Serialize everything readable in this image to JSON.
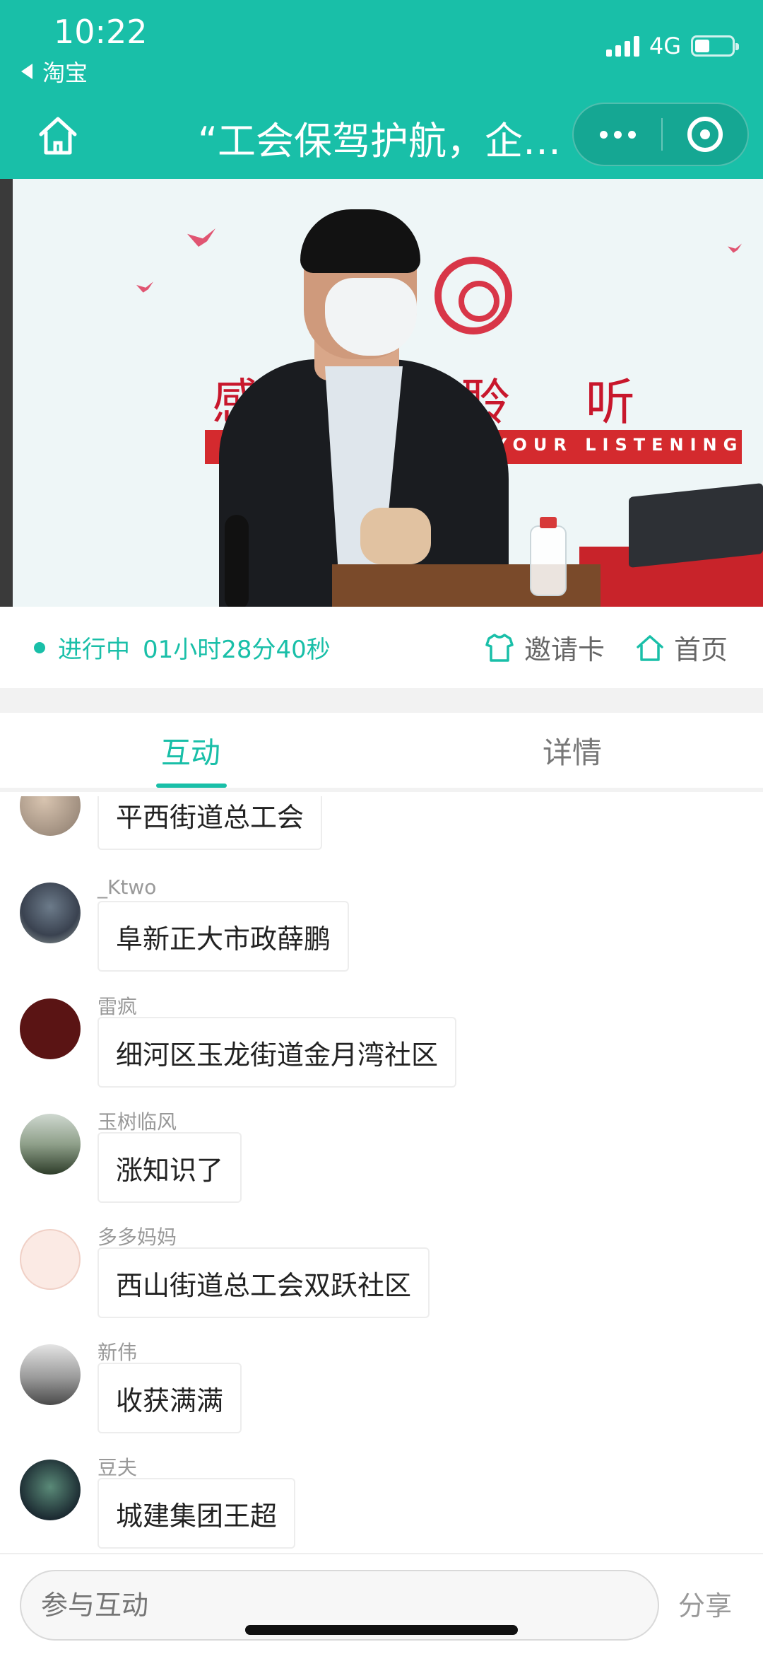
{
  "status_bar": {
    "time": "10:22",
    "back_app": "淘宝",
    "network": "4G",
    "battery_level": 0.4
  },
  "nav": {
    "title": "“工会保驾护航，企…"
  },
  "video": {
    "banner_text": "感 的 聆 听",
    "banner_sub": "YOUR LISTENING"
  },
  "live": {
    "status": "进行中",
    "duration": "01小时28分40秒",
    "invite_label": "邀请卡",
    "home_label": "首页"
  },
  "tabs": [
    {
      "label": "互动",
      "active": true
    },
    {
      "label": "详情",
      "active": false
    }
  ],
  "messages": [
    {
      "name": "",
      "text": "平西街道总工会",
      "avatar_icon": "avatar-icon"
    },
    {
      "name": "_Ktwo",
      "text": "阜新正大市政薛鹏",
      "avatar_icon": "avatar-icon"
    },
    {
      "name": "雷疯",
      "text": "细河区玉龙街道金月湾社区",
      "avatar_icon": "avatar-icon"
    },
    {
      "name": "玉树临风",
      "text": "涨知识了",
      "avatar_icon": "avatar-icon"
    },
    {
      "name": "多多妈妈",
      "text": "西山街道总工会双跃社区",
      "avatar_icon": "avatar-icon"
    },
    {
      "name": "新伟",
      "text": "收获满满",
      "avatar_icon": "avatar-icon"
    },
    {
      "name": "豆夫",
      "text": "城建集团王超",
      "avatar_icon": "avatar-icon"
    }
  ],
  "bottom": {
    "input_placeholder": "参与互动",
    "share_label": "分享"
  },
  "colors": {
    "brand": "#19bfa8"
  }
}
